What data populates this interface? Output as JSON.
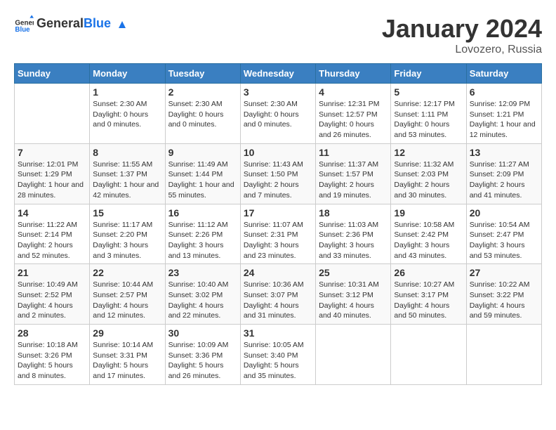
{
  "header": {
    "logo_general": "General",
    "logo_blue": "Blue",
    "month": "January 2024",
    "location": "Lovozero, Russia"
  },
  "weekdays": [
    "Sunday",
    "Monday",
    "Tuesday",
    "Wednesday",
    "Thursday",
    "Friday",
    "Saturday"
  ],
  "weeks": [
    [
      {
        "day": "",
        "info": ""
      },
      {
        "day": "1",
        "info": "Sunset: 2:30 AM\nDaylight: 0 hours and 0 minutes."
      },
      {
        "day": "2",
        "info": "Sunset: 2:30 AM\nDaylight: 0 hours and 0 minutes."
      },
      {
        "day": "3",
        "info": "Sunset: 2:30 AM\nDaylight: 0 hours and 0 minutes."
      },
      {
        "day": "4",
        "info": "Sunrise: 12:31 PM\nSunset: 12:57 PM\nDaylight: 0 hours and 26 minutes."
      },
      {
        "day": "5",
        "info": "Sunrise: 12:17 PM\nSunset: 1:11 PM\nDaylight: 0 hours and 53 minutes."
      },
      {
        "day": "6",
        "info": "Sunrise: 12:09 PM\nSunset: 1:21 PM\nDaylight: 1 hour and 12 minutes."
      }
    ],
    [
      {
        "day": "7",
        "info": "Sunrise: 12:01 PM\nSunset: 1:29 PM\nDaylight: 1 hour and 28 minutes."
      },
      {
        "day": "8",
        "info": "Sunrise: 11:55 AM\nSunset: 1:37 PM\nDaylight: 1 hour and 42 minutes."
      },
      {
        "day": "9",
        "info": "Sunrise: 11:49 AM\nSunset: 1:44 PM\nDaylight: 1 hour and 55 minutes."
      },
      {
        "day": "10",
        "info": "Sunrise: 11:43 AM\nSunset: 1:50 PM\nDaylight: 2 hours and 7 minutes."
      },
      {
        "day": "11",
        "info": "Sunrise: 11:37 AM\nSunset: 1:57 PM\nDaylight: 2 hours and 19 minutes."
      },
      {
        "day": "12",
        "info": "Sunrise: 11:32 AM\nSunset: 2:03 PM\nDaylight: 2 hours and 30 minutes."
      },
      {
        "day": "13",
        "info": "Sunrise: 11:27 AM\nSunset: 2:09 PM\nDaylight: 2 hours and 41 minutes."
      }
    ],
    [
      {
        "day": "14",
        "info": "Sunrise: 11:22 AM\nSunset: 2:14 PM\nDaylight: 2 hours and 52 minutes."
      },
      {
        "day": "15",
        "info": "Sunrise: 11:17 AM\nSunset: 2:20 PM\nDaylight: 3 hours and 3 minutes."
      },
      {
        "day": "16",
        "info": "Sunrise: 11:12 AM\nSunset: 2:26 PM\nDaylight: 3 hours and 13 minutes."
      },
      {
        "day": "17",
        "info": "Sunrise: 11:07 AM\nSunset: 2:31 PM\nDaylight: 3 hours and 23 minutes."
      },
      {
        "day": "18",
        "info": "Sunrise: 11:03 AM\nSunset: 2:36 PM\nDaylight: 3 hours and 33 minutes."
      },
      {
        "day": "19",
        "info": "Sunrise: 10:58 AM\nSunset: 2:42 PM\nDaylight: 3 hours and 43 minutes."
      },
      {
        "day": "20",
        "info": "Sunrise: 10:54 AM\nSunset: 2:47 PM\nDaylight: 3 hours and 53 minutes."
      }
    ],
    [
      {
        "day": "21",
        "info": "Sunrise: 10:49 AM\nSunset: 2:52 PM\nDaylight: 4 hours and 2 minutes."
      },
      {
        "day": "22",
        "info": "Sunrise: 10:44 AM\nSunset: 2:57 PM\nDaylight: 4 hours and 12 minutes."
      },
      {
        "day": "23",
        "info": "Sunrise: 10:40 AM\nSunset: 3:02 PM\nDaylight: 4 hours and 22 minutes."
      },
      {
        "day": "24",
        "info": "Sunrise: 10:36 AM\nSunset: 3:07 PM\nDaylight: 4 hours and 31 minutes."
      },
      {
        "day": "25",
        "info": "Sunrise: 10:31 AM\nSunset: 3:12 PM\nDaylight: 4 hours and 40 minutes."
      },
      {
        "day": "26",
        "info": "Sunrise: 10:27 AM\nSunset: 3:17 PM\nDaylight: 4 hours and 50 minutes."
      },
      {
        "day": "27",
        "info": "Sunrise: 10:22 AM\nSunset: 3:22 PM\nDaylight: 4 hours and 59 minutes."
      }
    ],
    [
      {
        "day": "28",
        "info": "Sunrise: 10:18 AM\nSunset: 3:26 PM\nDaylight: 5 hours and 8 minutes."
      },
      {
        "day": "29",
        "info": "Sunrise: 10:14 AM\nSunset: 3:31 PM\nDaylight: 5 hours and 17 minutes."
      },
      {
        "day": "30",
        "info": "Sunrise: 10:09 AM\nSunset: 3:36 PM\nDaylight: 5 hours and 26 minutes."
      },
      {
        "day": "31",
        "info": "Sunrise: 10:05 AM\nSunset: 3:40 PM\nDaylight: 5 hours and 35 minutes."
      },
      {
        "day": "",
        "info": ""
      },
      {
        "day": "",
        "info": ""
      },
      {
        "day": "",
        "info": ""
      }
    ]
  ]
}
